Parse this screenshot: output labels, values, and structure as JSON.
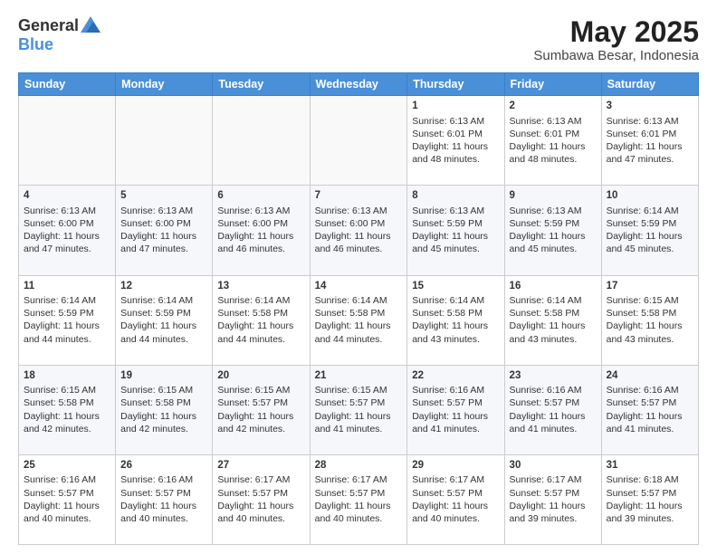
{
  "logo": {
    "general": "General",
    "blue": "Blue"
  },
  "header": {
    "month": "May 2025",
    "location": "Sumbawa Besar, Indonesia"
  },
  "weekdays": [
    "Sunday",
    "Monday",
    "Tuesday",
    "Wednesday",
    "Thursday",
    "Friday",
    "Saturday"
  ],
  "weeks": [
    [
      {
        "day": "",
        "info": ""
      },
      {
        "day": "",
        "info": ""
      },
      {
        "day": "",
        "info": ""
      },
      {
        "day": "",
        "info": ""
      },
      {
        "day": "1",
        "info": "Sunrise: 6:13 AM\nSunset: 6:01 PM\nDaylight: 11 hours and 48 minutes."
      },
      {
        "day": "2",
        "info": "Sunrise: 6:13 AM\nSunset: 6:01 PM\nDaylight: 11 hours and 48 minutes."
      },
      {
        "day": "3",
        "info": "Sunrise: 6:13 AM\nSunset: 6:01 PM\nDaylight: 11 hours and 47 minutes."
      }
    ],
    [
      {
        "day": "4",
        "info": "Sunrise: 6:13 AM\nSunset: 6:00 PM\nDaylight: 11 hours and 47 minutes."
      },
      {
        "day": "5",
        "info": "Sunrise: 6:13 AM\nSunset: 6:00 PM\nDaylight: 11 hours and 47 minutes."
      },
      {
        "day": "6",
        "info": "Sunrise: 6:13 AM\nSunset: 6:00 PM\nDaylight: 11 hours and 46 minutes."
      },
      {
        "day": "7",
        "info": "Sunrise: 6:13 AM\nSunset: 6:00 PM\nDaylight: 11 hours and 46 minutes."
      },
      {
        "day": "8",
        "info": "Sunrise: 6:13 AM\nSunset: 5:59 PM\nDaylight: 11 hours and 45 minutes."
      },
      {
        "day": "9",
        "info": "Sunrise: 6:13 AM\nSunset: 5:59 PM\nDaylight: 11 hours and 45 minutes."
      },
      {
        "day": "10",
        "info": "Sunrise: 6:14 AM\nSunset: 5:59 PM\nDaylight: 11 hours and 45 minutes."
      }
    ],
    [
      {
        "day": "11",
        "info": "Sunrise: 6:14 AM\nSunset: 5:59 PM\nDaylight: 11 hours and 44 minutes."
      },
      {
        "day": "12",
        "info": "Sunrise: 6:14 AM\nSunset: 5:59 PM\nDaylight: 11 hours and 44 minutes."
      },
      {
        "day": "13",
        "info": "Sunrise: 6:14 AM\nSunset: 5:58 PM\nDaylight: 11 hours and 44 minutes."
      },
      {
        "day": "14",
        "info": "Sunrise: 6:14 AM\nSunset: 5:58 PM\nDaylight: 11 hours and 44 minutes."
      },
      {
        "day": "15",
        "info": "Sunrise: 6:14 AM\nSunset: 5:58 PM\nDaylight: 11 hours and 43 minutes."
      },
      {
        "day": "16",
        "info": "Sunrise: 6:14 AM\nSunset: 5:58 PM\nDaylight: 11 hours and 43 minutes."
      },
      {
        "day": "17",
        "info": "Sunrise: 6:15 AM\nSunset: 5:58 PM\nDaylight: 11 hours and 43 minutes."
      }
    ],
    [
      {
        "day": "18",
        "info": "Sunrise: 6:15 AM\nSunset: 5:58 PM\nDaylight: 11 hours and 42 minutes."
      },
      {
        "day": "19",
        "info": "Sunrise: 6:15 AM\nSunset: 5:58 PM\nDaylight: 11 hours and 42 minutes."
      },
      {
        "day": "20",
        "info": "Sunrise: 6:15 AM\nSunset: 5:57 PM\nDaylight: 11 hours and 42 minutes."
      },
      {
        "day": "21",
        "info": "Sunrise: 6:15 AM\nSunset: 5:57 PM\nDaylight: 11 hours and 41 minutes."
      },
      {
        "day": "22",
        "info": "Sunrise: 6:16 AM\nSunset: 5:57 PM\nDaylight: 11 hours and 41 minutes."
      },
      {
        "day": "23",
        "info": "Sunrise: 6:16 AM\nSunset: 5:57 PM\nDaylight: 11 hours and 41 minutes."
      },
      {
        "day": "24",
        "info": "Sunrise: 6:16 AM\nSunset: 5:57 PM\nDaylight: 11 hours and 41 minutes."
      }
    ],
    [
      {
        "day": "25",
        "info": "Sunrise: 6:16 AM\nSunset: 5:57 PM\nDaylight: 11 hours and 40 minutes."
      },
      {
        "day": "26",
        "info": "Sunrise: 6:16 AM\nSunset: 5:57 PM\nDaylight: 11 hours and 40 minutes."
      },
      {
        "day": "27",
        "info": "Sunrise: 6:17 AM\nSunset: 5:57 PM\nDaylight: 11 hours and 40 minutes."
      },
      {
        "day": "28",
        "info": "Sunrise: 6:17 AM\nSunset: 5:57 PM\nDaylight: 11 hours and 40 minutes."
      },
      {
        "day": "29",
        "info": "Sunrise: 6:17 AM\nSunset: 5:57 PM\nDaylight: 11 hours and 40 minutes."
      },
      {
        "day": "30",
        "info": "Sunrise: 6:17 AM\nSunset: 5:57 PM\nDaylight: 11 hours and 39 minutes."
      },
      {
        "day": "31",
        "info": "Sunrise: 6:18 AM\nSunset: 5:57 PM\nDaylight: 11 hours and 39 minutes."
      }
    ]
  ]
}
